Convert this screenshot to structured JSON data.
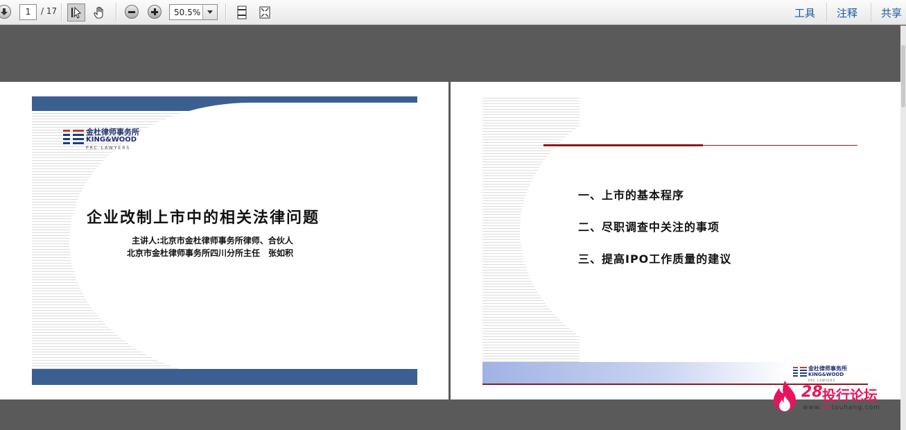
{
  "toolbar": {
    "current_page": "1",
    "page_total": "/ 17",
    "zoom": "50.5%",
    "right_links": [
      "工具",
      "注释",
      "共享"
    ]
  },
  "slide1": {
    "logo_cn": "金杜律师事务所",
    "logo_en": "KING&WOOD",
    "logo_sub": "PRC LAWYERS",
    "title": "企业改制上市中的相关法律问题",
    "speaker_line1": "主讲人:北京市金杜律师事务所律师、合伙人",
    "speaker_line2": "北京市金杜律师事务所四川分所主任　张如积"
  },
  "slide2": {
    "items": [
      "一、上市的基本程序",
      "二、尽职调查中关注的事项",
      "三、提高IPO工作质量的建议"
    ],
    "logo_cn": "金杜律师事务所",
    "logo_en": "KING&WOOD",
    "logo_sub": "PRC LAWYERS"
  },
  "watermark": {
    "number": "28",
    "text": "投行论坛",
    "url_prefix": "www.",
    "url_mid": "28",
    "url_suffix": "touhang.com"
  },
  "colors": {
    "toolbar_link": "#1d5a9c",
    "slide_bar": "#3b5f91",
    "red_rule": "#8b1a1a",
    "watermark": "#e8145a"
  }
}
